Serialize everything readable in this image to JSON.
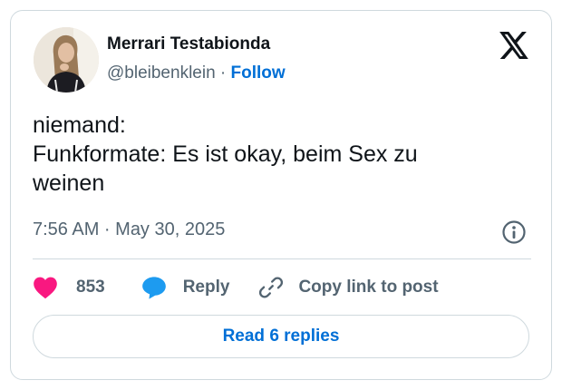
{
  "author": {
    "name": "Merrari Testabionda",
    "handle": "@bleibenklein",
    "separator": "·",
    "follow_label": "Follow"
  },
  "tweet": {
    "lines": [
      "niemand:",
      "Funkformate: Es ist okay, beim Sex zu",
      "weinen"
    ],
    "timestamp": "7:56 AM · May 30, 2025"
  },
  "actions": {
    "like_count": "853",
    "reply_label": "Reply",
    "copy_link_label": "Copy link to post"
  },
  "read_replies_label": "Read 6 replies",
  "icons": {
    "logo": "x-logo-icon",
    "info": "info-icon",
    "like": "heart-icon",
    "reply": "speech-bubble-icon",
    "copy_link": "link-icon"
  },
  "colors": {
    "text": "#0f1419",
    "secondary": "#536471",
    "link": "#006fd6",
    "like": "#f91880",
    "reply": "#1d9bf0",
    "border": "#cfd9de"
  }
}
